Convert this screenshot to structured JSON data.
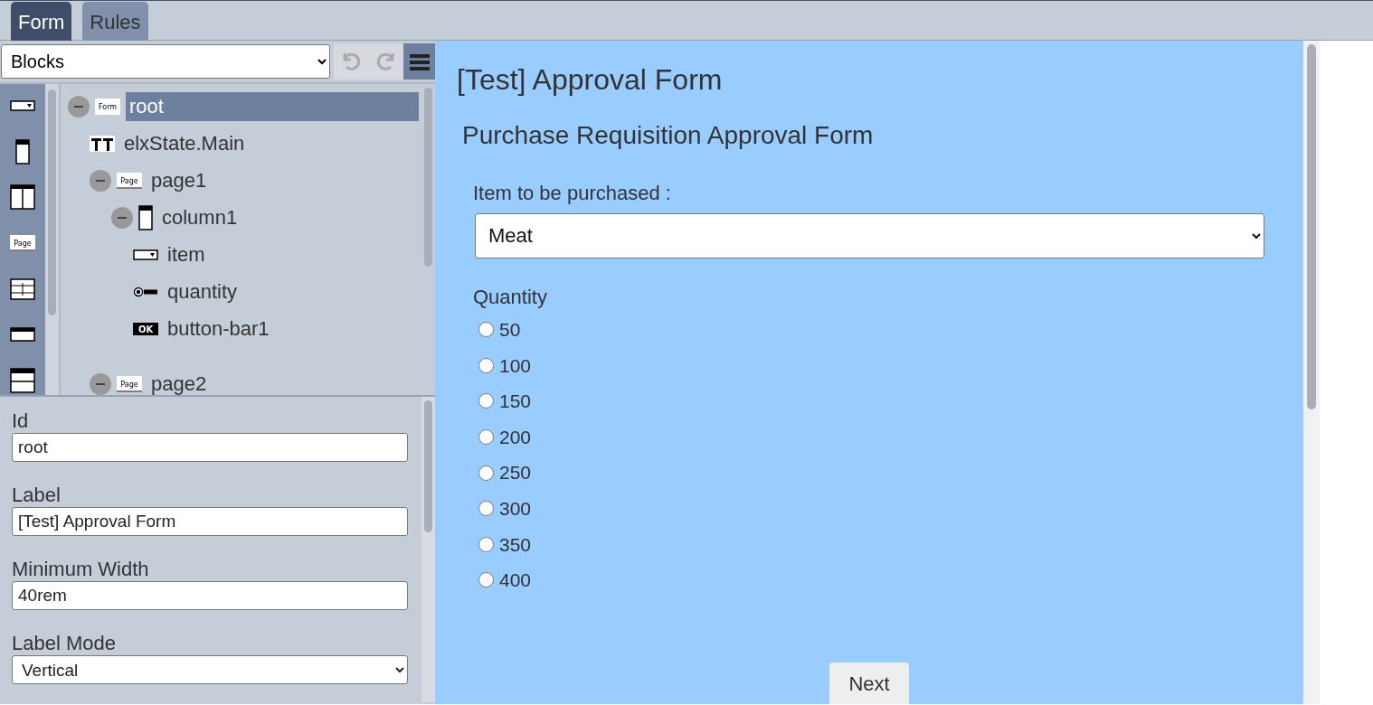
{
  "tabs": [
    {
      "label": "Form",
      "selected": true
    },
    {
      "label": "Rules",
      "selected": false
    }
  ],
  "toolbar": {
    "select_value": "Blocks",
    "undo_disabled": true,
    "redo_disabled": true
  },
  "palette": [
    {
      "kind": "dropdown"
    },
    {
      "kind": "column"
    },
    {
      "kind": "columns"
    },
    {
      "kind": "page",
      "icon_text": "Page"
    },
    {
      "kind": "grid"
    },
    {
      "kind": "bar"
    },
    {
      "kind": "section"
    }
  ],
  "tree": [
    {
      "label": "root",
      "kind": "form",
      "icon_text": "Form",
      "selected": true,
      "expanded": true,
      "children": [
        {
          "label": "elxState.Main",
          "kind": "text",
          "selected": false
        },
        {
          "label": "page1",
          "kind": "page",
          "icon_text": "Page",
          "selected": false,
          "expanded": true,
          "children": [
            {
              "label": "column1",
              "kind": "column",
              "selected": false,
              "expanded": true,
              "children": [
                {
                  "label": "item",
                  "kind": "dropdown",
                  "selected": false
                },
                {
                  "label": "quantity",
                  "kind": "radio",
                  "selected": false
                },
                {
                  "label": "button-bar1",
                  "kind": "ok",
                  "icon_text": "OK",
                  "selected": false
                }
              ]
            }
          ]
        },
        {
          "label": "page2",
          "kind": "page",
          "icon_text": "Page",
          "selected": false,
          "expanded": true
        }
      ]
    }
  ],
  "properties": [
    {
      "label": "Id",
      "kind": "text",
      "value": "root"
    },
    {
      "label": "Label",
      "kind": "text",
      "value": "[Test] Approval Form"
    },
    {
      "label": "Minimum Width",
      "kind": "text",
      "value": "40rem"
    },
    {
      "label": "Label Mode",
      "kind": "select",
      "value": "Vertical"
    }
  ],
  "form": {
    "title": "[Test] Approval Form",
    "page_title": "Purchase Requisition Approval Form",
    "item_label": "Item to be purchased :",
    "item_value": "Meat",
    "quantity_label": "Quantity",
    "quantity_options": [
      {
        "label": "50",
        "selected": false
      },
      {
        "label": "100",
        "selected": false
      },
      {
        "label": "150",
        "selected": false
      },
      {
        "label": "200",
        "selected": false
      },
      {
        "label": "250",
        "selected": false
      },
      {
        "label": "300",
        "selected": false
      },
      {
        "label": "350",
        "selected": false
      },
      {
        "label": "400",
        "selected": false
      }
    ],
    "next_button": "Next"
  }
}
